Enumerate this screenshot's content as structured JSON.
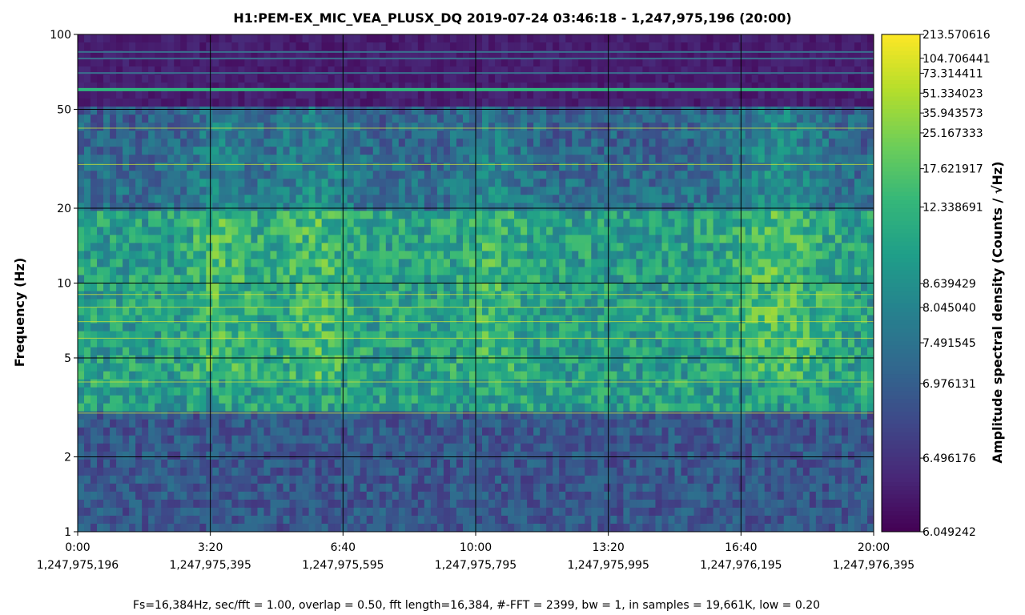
{
  "chart_data": {
    "type": "heatmap",
    "title": "H1:PEM-EX_MIC_VEA_PLUSX_DQ 2019-07-24 03:46:18 - 1,247,975,196 (20:00)",
    "ylabel": "Frequency (Hz)",
    "colorbar_label": "Amplitude spectral density (Counts / √Hz)",
    "footer": "Fs=16,384Hz, sec/fft = 1.00, overlap = 0.50, fft length=16,384, #-FFT = 2399, bw = 1, in samples = 19,661K, low = 0.20",
    "y_scale": "log",
    "ylim": [
      1,
      100
    ],
    "y_ticks": [
      {
        "value": 1,
        "label": "1"
      },
      {
        "value": 2,
        "label": "2"
      },
      {
        "value": 5,
        "label": "5"
      },
      {
        "value": 10,
        "label": "10"
      },
      {
        "value": 20,
        "label": "20"
      },
      {
        "value": 50,
        "label": "50"
      },
      {
        "value": 100,
        "label": "100"
      }
    ],
    "xlim": [
      0,
      1200
    ],
    "x_ticks": [
      {
        "value": 0,
        "label": "0:00",
        "gps": "1,247,975,196"
      },
      {
        "value": 200,
        "label": "3:20",
        "gps": "1,247,975,395"
      },
      {
        "value": 400,
        "label": "6:40",
        "gps": "1,247,975,595"
      },
      {
        "value": 600,
        "label": "10:00",
        "gps": "1,247,975,795"
      },
      {
        "value": 800,
        "label": "13:20",
        "gps": "1,247,975,995"
      },
      {
        "value": 1000,
        "label": "16:40",
        "gps": "1,247,976,195"
      },
      {
        "value": 1200,
        "label": "20:00",
        "gps": "1,247,976,395"
      }
    ],
    "colorbar_scale": "nonlinear",
    "colorbar_ticks": [
      "213.570616",
      "104.706441",
      "73.314411",
      "51.334023",
      "35.943573",
      "25.167333",
      "17.621917",
      "12.338691",
      "8.639429",
      "8.045040",
      "7.491545",
      "6.976131",
      "6.496176",
      "6.049242"
    ],
    "colormap": [
      "#440154",
      "#482878",
      "#3e4989",
      "#31688e",
      "#26828e",
      "#1f9e89",
      "#35b779",
      "#6ece58",
      "#b5de2b",
      "#fde725"
    ],
    "spectral_lines_hz": [
      3,
      4,
      6,
      7,
      8,
      9,
      30,
      42
    ],
    "strong_lines_hz": [
      60
    ],
    "faint_lines_hz": [
      70,
      80,
      85
    ],
    "grid": true,
    "grid_color": "#000000"
  }
}
